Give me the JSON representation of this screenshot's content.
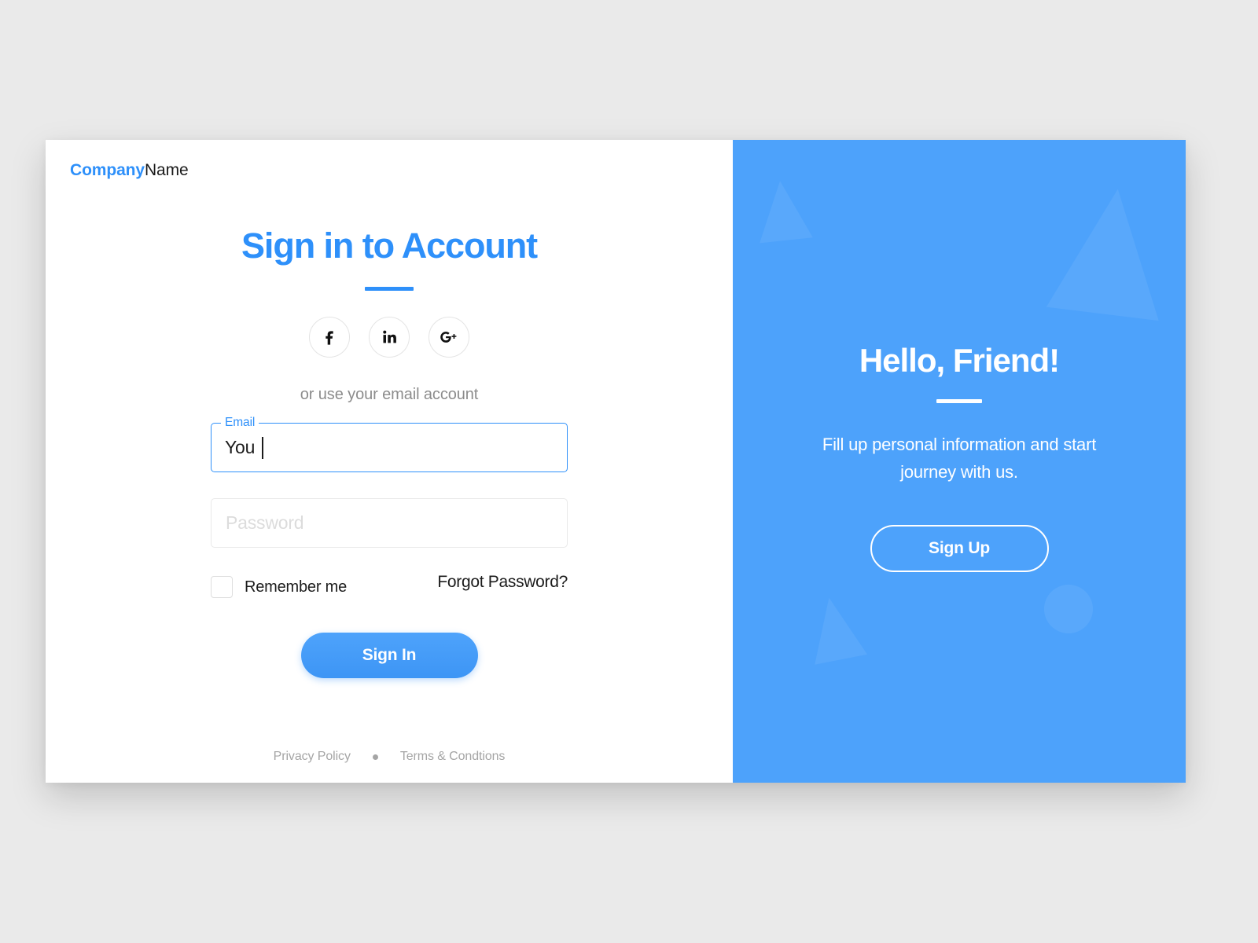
{
  "brand": {
    "company": "Company",
    "name": "Name"
  },
  "signin": {
    "title": "Sign in to Account",
    "social_prompt": "or use your email account",
    "socials": [
      {
        "name": "facebook",
        "glyph": "f"
      },
      {
        "name": "linkedin",
        "glyph": "in"
      },
      {
        "name": "googleplus",
        "glyph": "G+"
      }
    ],
    "email": {
      "label": "Email",
      "value": "You"
    },
    "password": {
      "placeholder": "Password"
    },
    "remember_label": "Remember me",
    "remember_checked": false,
    "forgot_label": "Forgot Password?",
    "submit_label": "Sign In"
  },
  "footer": {
    "privacy": "Privacy Policy",
    "terms": "Terms & Condtions"
  },
  "promo": {
    "title": "Hello, Friend!",
    "subtitle": "Fill up personal information and start journey with us.",
    "signup_label": "Sign Up"
  },
  "colors": {
    "accent": "#2e90fa",
    "panel": "#4da2fb",
    "page_bg": "#eaeaea",
    "card_bg": "#ffffff",
    "muted_text": "#8c8c8c",
    "footer_text": "#a5a5a5"
  }
}
